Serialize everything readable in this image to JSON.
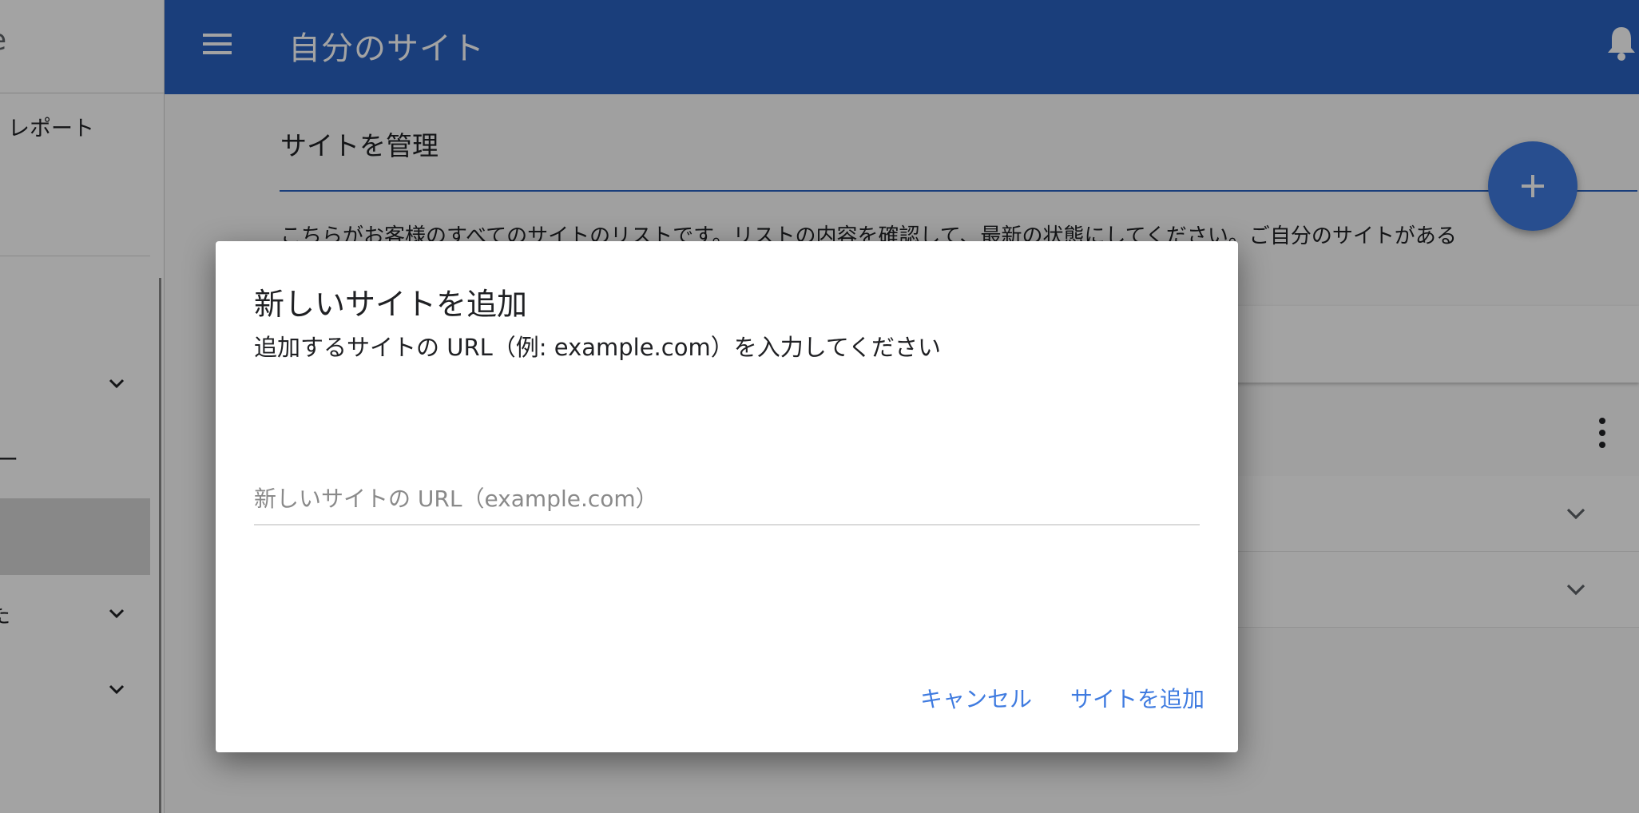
{
  "sidebar": {
    "brand": "e",
    "items": [
      {
        "label": "レポート"
      },
      {
        "label": ""
      },
      {
        "label": "ー"
      },
      {
        "label": ""
      },
      {
        "label": "た"
      },
      {
        "label": ""
      }
    ]
  },
  "appbar": {
    "title": "自分のサイト",
    "menu_icon": "menu-icon",
    "notification_icon": "bell-icon"
  },
  "main": {
    "section_title": "サイトを管理",
    "description": "こちらがお客様のすべてのサイトのリストです。リストの内容を確認して、最新の状態にしてください。ご自分のサイトがある",
    "fab_icon": "plus-icon"
  },
  "dialog": {
    "title": "新しいサイトを追加",
    "subtitle": "追加するサイトの URL（例: example.com）を入力してください",
    "input": {
      "placeholder": "新しいサイトの URL（example.com）",
      "value": ""
    },
    "cancel_label": "キャンセル",
    "add_label": "サイトを追加"
  },
  "colors": {
    "primary": "#2962c0",
    "accent": "#3f7be0",
    "scrim": "rgba(0,0,0,0.36)"
  }
}
